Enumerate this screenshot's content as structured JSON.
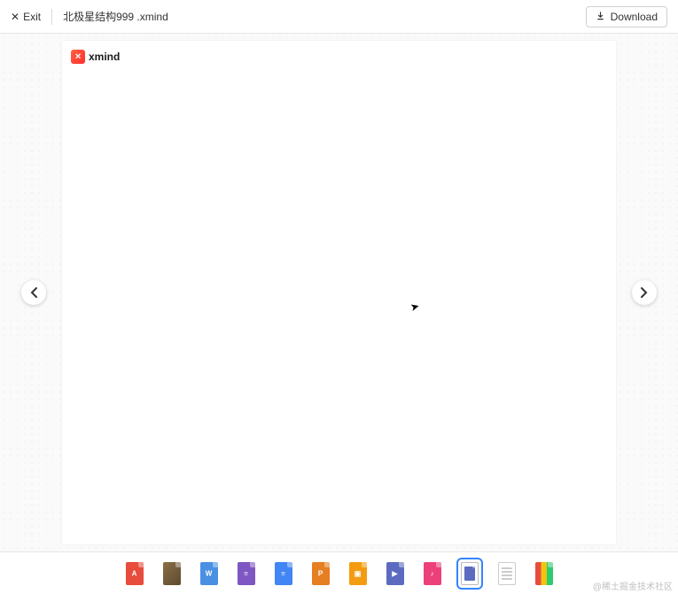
{
  "header": {
    "exit_label": "Exit",
    "filename": "北极星结构999 .xmind",
    "download_label": "Download"
  },
  "brand": {
    "name": "xmind"
  },
  "thumbnails": [
    {
      "name": "pdf",
      "selected": false
    },
    {
      "name": "image",
      "selected": false
    },
    {
      "name": "docx",
      "selected": false
    },
    {
      "name": "list",
      "selected": false
    },
    {
      "name": "doc",
      "selected": false
    },
    {
      "name": "ppt",
      "selected": false
    },
    {
      "name": "pptx",
      "selected": false
    },
    {
      "name": "video",
      "selected": false
    },
    {
      "name": "audio",
      "selected": false
    },
    {
      "name": "form",
      "selected": true
    },
    {
      "name": "blank",
      "selected": false
    },
    {
      "name": "rainbow",
      "selected": false
    }
  ],
  "watermark": "@稀土掘金技术社区"
}
